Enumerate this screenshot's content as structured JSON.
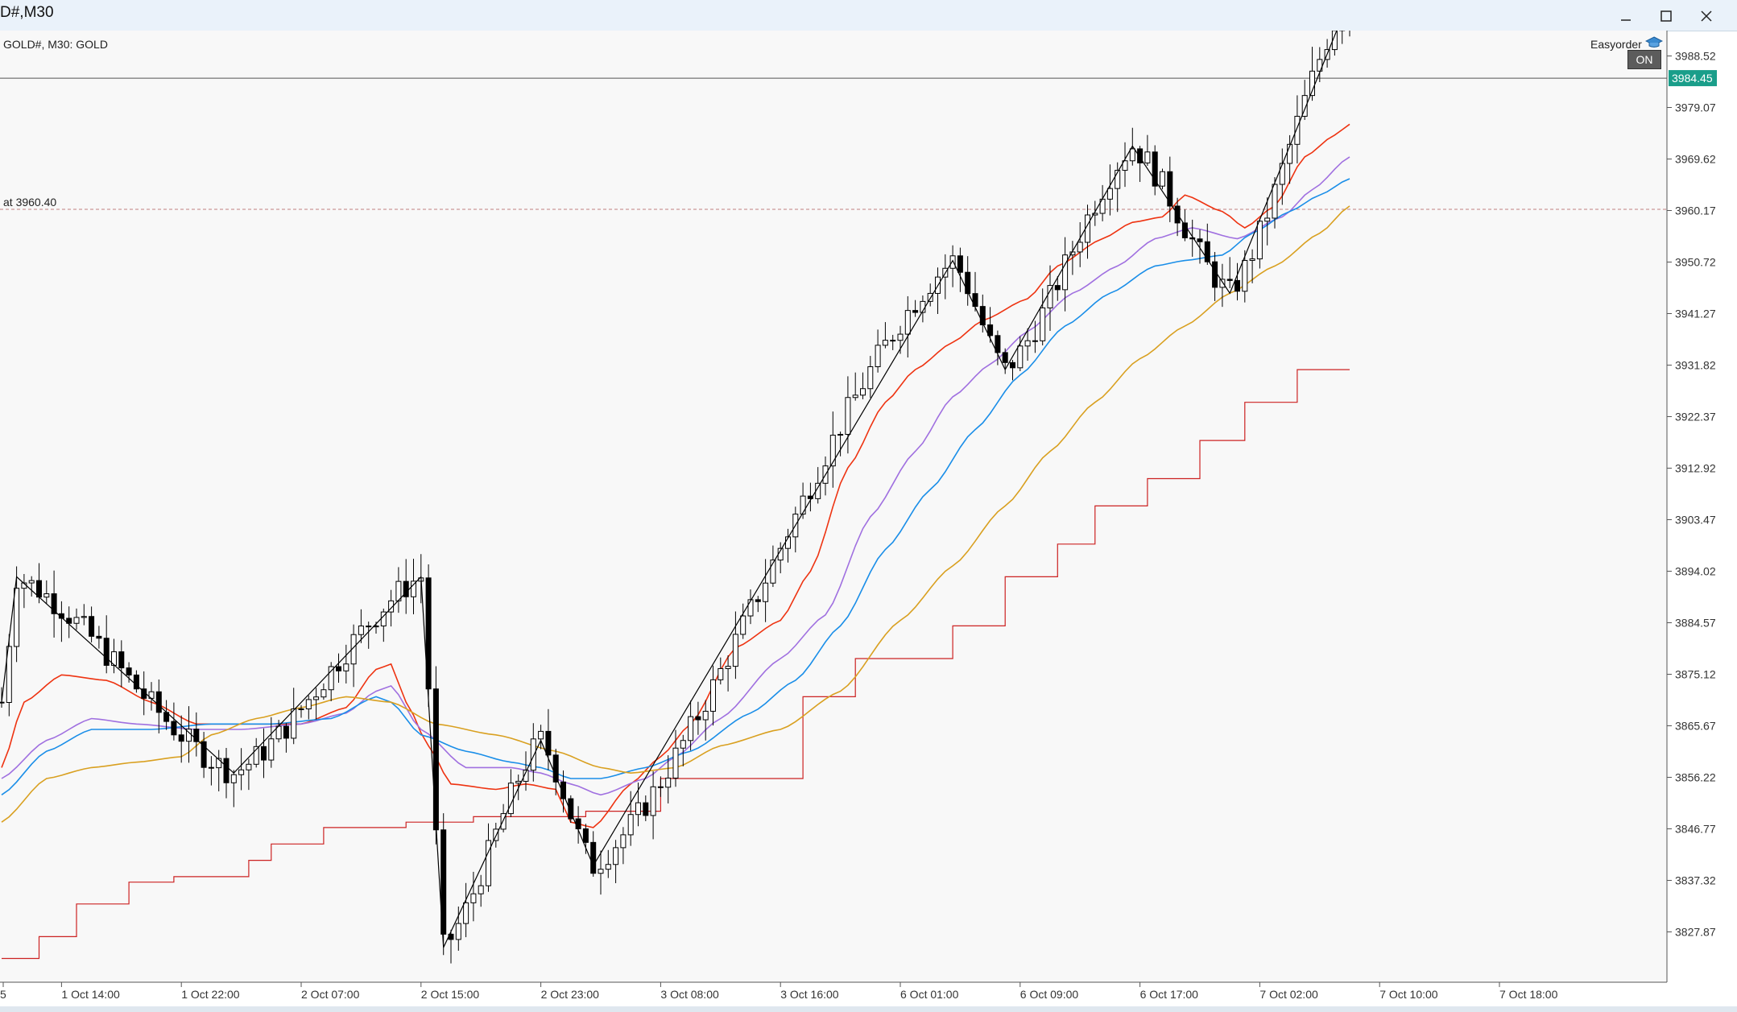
{
  "window": {
    "title": "D#,M30",
    "minimize_icon": "minimize-icon",
    "maximize_icon": "maximize-icon",
    "close_icon": "close-icon"
  },
  "chart_header": {
    "symbol_text": "GOLD#, M30:  GOLD"
  },
  "expert_advisor": {
    "name": "Easyorder",
    "state": "ON",
    "icon": "graduation-cap-icon"
  },
  "colors": {
    "background": "#f8f8f8",
    "candle_bull": "#ffffff",
    "candle_bear": "#000000",
    "ma_fast": "#ee3311",
    "ma_purple": "#a070e0",
    "ma_blue": "#1a8ee8",
    "ma_slow": "#d9a020",
    "step_line": "#cc2222",
    "zigzag": "#000000",
    "price_tag": "#1a9e8a",
    "alert_line": "#c08080"
  },
  "chart_data": {
    "type": "candlestick",
    "symbol": "GOLD#",
    "timeframe": "M30",
    "ylim": [
      3818.5,
      4000.0
    ],
    "y_ticks": [
      "3988.52",
      "3979.07",
      "3969.62",
      "3960.17",
      "3950.72",
      "3941.27",
      "3931.82",
      "3922.37",
      "3912.92",
      "3903.47",
      "3894.02",
      "3884.57",
      "3875.12",
      "3865.67",
      "3856.22",
      "3846.77",
      "3837.32",
      "3827.87"
    ],
    "x_ticks": [
      "5",
      "1 Oct 14:00",
      "1 Oct 22:00",
      "2 Oct 07:00",
      "2 Oct 15:00",
      "2 Oct 23:00",
      "3 Oct 08:00",
      "3 Oct 16:00",
      "6 Oct 01:00",
      "6 Oct 09:00",
      "6 Oct 17:00",
      "7 Oct 02:00",
      "7 Oct 10:00",
      "7 Oct 18:00"
    ],
    "current_price": "3984.45",
    "alert_line": {
      "label": "at 3960.40",
      "price": 3960.4
    },
    "zigzag_pivots": [
      [
        0,
        3870
      ],
      [
        2,
        3893
      ],
      [
        31,
        3857
      ],
      [
        56,
        3893
      ],
      [
        59,
        3825
      ],
      [
        72,
        3863
      ],
      [
        79,
        3840
      ],
      [
        127,
        3951
      ],
      [
        134,
        3931
      ],
      [
        151,
        3972
      ],
      [
        164,
        3945
      ],
      [
        180,
        3999
      ]
    ],
    "step_line": [
      [
        0,
        3823
      ],
      [
        5,
        3823
      ],
      [
        5,
        3827
      ],
      [
        10,
        3827
      ],
      [
        10,
        3833
      ],
      [
        17,
        3833
      ],
      [
        17,
        3837
      ],
      [
        23,
        3837
      ],
      [
        23,
        3838
      ],
      [
        33,
        3838
      ],
      [
        33,
        3841
      ],
      [
        36,
        3841
      ],
      [
        36,
        3844
      ],
      [
        43,
        3844
      ],
      [
        43,
        3847
      ],
      [
        54,
        3847
      ],
      [
        54,
        3848
      ],
      [
        63,
        3848
      ],
      [
        63,
        3849
      ],
      [
        78,
        3849
      ],
      [
        78,
        3850
      ],
      [
        88,
        3850
      ],
      [
        88,
        3856
      ],
      [
        107,
        3856
      ],
      [
        107,
        3871
      ],
      [
        114,
        3871
      ],
      [
        114,
        3878
      ],
      [
        127,
        3878
      ],
      [
        127,
        3884
      ],
      [
        134,
        3884
      ],
      [
        134,
        3893
      ],
      [
        141,
        3893
      ],
      [
        141,
        3899
      ],
      [
        146,
        3899
      ],
      [
        146,
        3906
      ],
      [
        153,
        3906
      ],
      [
        153,
        3911
      ],
      [
        160,
        3911
      ],
      [
        160,
        3918
      ],
      [
        166,
        3918
      ],
      [
        166,
        3925
      ],
      [
        173,
        3925
      ],
      [
        173,
        3931
      ],
      [
        180,
        3931
      ]
    ],
    "series": [
      {
        "key": "ma_fast",
        "values": [
          [
            0,
            3858
          ],
          [
            3,
            3870
          ],
          [
            8,
            3875
          ],
          [
            14,
            3874
          ],
          [
            20,
            3870
          ],
          [
            26,
            3866
          ],
          [
            32,
            3866
          ],
          [
            40,
            3866
          ],
          [
            46,
            3869
          ],
          [
            50,
            3876
          ],
          [
            52,
            3877
          ],
          [
            54,
            3870
          ],
          [
            57,
            3862
          ],
          [
            60,
            3855
          ],
          [
            66,
            3854
          ],
          [
            70,
            3855
          ],
          [
            74,
            3854
          ],
          [
            76,
            3848
          ],
          [
            79,
            3847
          ],
          [
            84,
            3855
          ],
          [
            88,
            3860
          ],
          [
            92,
            3866
          ],
          [
            98,
            3880
          ],
          [
            104,
            3885
          ],
          [
            108,
            3894
          ],
          [
            113,
            3913
          ],
          [
            118,
            3925
          ],
          [
            122,
            3931
          ],
          [
            127,
            3936
          ],
          [
            131,
            3940
          ],
          [
            137,
            3944
          ],
          [
            141,
            3950
          ],
          [
            147,
            3955
          ],
          [
            151,
            3958
          ],
          [
            155,
            3959
          ],
          [
            158,
            3963
          ],
          [
            163,
            3960
          ],
          [
            166,
            3957
          ],
          [
            170,
            3961
          ],
          [
            174,
            3970
          ],
          [
            178,
            3974
          ],
          [
            180,
            3976
          ]
        ]
      },
      {
        "key": "ma_purple",
        "values": [
          [
            0,
            3856
          ],
          [
            6,
            3863
          ],
          [
            12,
            3867
          ],
          [
            18,
            3866
          ],
          [
            26,
            3865
          ],
          [
            32,
            3865
          ],
          [
            40,
            3866
          ],
          [
            46,
            3868
          ],
          [
            50,
            3872
          ],
          [
            52,
            3873
          ],
          [
            56,
            3865
          ],
          [
            62,
            3858
          ],
          [
            68,
            3858
          ],
          [
            72,
            3857
          ],
          [
            76,
            3855
          ],
          [
            80,
            3853
          ],
          [
            86,
            3856
          ],
          [
            90,
            3860
          ],
          [
            96,
            3867
          ],
          [
            104,
            3878
          ],
          [
            110,
            3886
          ],
          [
            116,
            3904
          ],
          [
            122,
            3916
          ],
          [
            127,
            3926
          ],
          [
            132,
            3932
          ],
          [
            137,
            3938
          ],
          [
            143,
            3945
          ],
          [
            149,
            3950
          ],
          [
            154,
            3955
          ],
          [
            159,
            3957
          ],
          [
            165,
            3955
          ],
          [
            171,
            3959
          ],
          [
            175,
            3964
          ],
          [
            180,
            3970
          ]
        ]
      },
      {
        "key": "ma_blue",
        "values": [
          [
            0,
            3853
          ],
          [
            6,
            3861
          ],
          [
            12,
            3865
          ],
          [
            20,
            3865
          ],
          [
            28,
            3866
          ],
          [
            36,
            3866
          ],
          [
            44,
            3867
          ],
          [
            50,
            3871
          ],
          [
            52,
            3870
          ],
          [
            56,
            3864
          ],
          [
            62,
            3861
          ],
          [
            68,
            3859
          ],
          [
            72,
            3858
          ],
          [
            76,
            3856
          ],
          [
            80,
            3856
          ],
          [
            86,
            3858
          ],
          [
            92,
            3861
          ],
          [
            100,
            3868
          ],
          [
            106,
            3874
          ],
          [
            112,
            3884
          ],
          [
            118,
            3898
          ],
          [
            124,
            3909
          ],
          [
            130,
            3920
          ],
          [
            136,
            3930
          ],
          [
            142,
            3939
          ],
          [
            148,
            3945
          ],
          [
            154,
            3950
          ],
          [
            158,
            3951
          ],
          [
            163,
            3952
          ],
          [
            167,
            3956
          ],
          [
            172,
            3960
          ],
          [
            176,
            3963
          ],
          [
            180,
            3966
          ]
        ]
      },
      {
        "key": "ma_slow",
        "values": [
          [
            0,
            3848
          ],
          [
            6,
            3856
          ],
          [
            12,
            3858
          ],
          [
            18,
            3859
          ],
          [
            24,
            3860
          ],
          [
            28,
            3864
          ],
          [
            34,
            3867
          ],
          [
            40,
            3869
          ],
          [
            46,
            3871
          ],
          [
            52,
            3870
          ],
          [
            58,
            3866
          ],
          [
            66,
            3864
          ],
          [
            74,
            3861
          ],
          [
            80,
            3858
          ],
          [
            84,
            3857
          ],
          [
            90,
            3858
          ],
          [
            96,
            3862
          ],
          [
            104,
            3865
          ],
          [
            112,
            3872
          ],
          [
            120,
            3885
          ],
          [
            127,
            3895
          ],
          [
            134,
            3906
          ],
          [
            140,
            3916
          ],
          [
            146,
            3925
          ],
          [
            152,
            3933
          ],
          [
            158,
            3939
          ],
          [
            164,
            3945
          ],
          [
            170,
            3950
          ],
          [
            176,
            3956
          ],
          [
            180,
            3961
          ]
        ]
      }
    ]
  }
}
